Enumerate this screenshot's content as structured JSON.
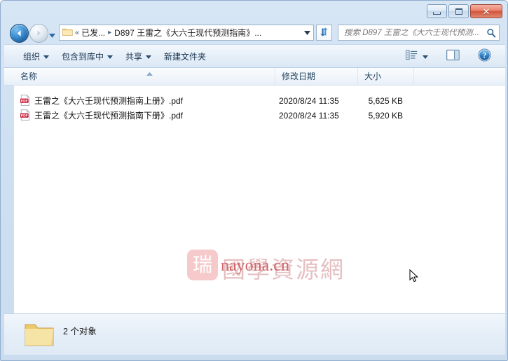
{
  "window": {
    "controls": {
      "minimize_label": "最小化",
      "maximize_label": "最大化",
      "close_label": "✕"
    }
  },
  "navbar": {
    "back_tooltip": "后退",
    "forward_tooltip": "前进",
    "recent_pages_tooltip": "最近浏览的页面",
    "breadcrumb": {
      "overflow": "«",
      "parent": "已发...",
      "separator": "▸",
      "current": "D897 王雷之《大六壬现代预测指南》",
      "ellipsis": "...",
      "dropdown_tooltip": "上一个位置"
    },
    "refresh_tooltip": "刷新"
  },
  "search": {
    "placeholder": "搜索 D897 王雷之《大六壬现代预测...",
    "value": "",
    "icon": "search-icon"
  },
  "toolbar": {
    "items": [
      {
        "label": "组织",
        "has_dropdown": true
      },
      {
        "label": "包含到库中",
        "has_dropdown": true
      },
      {
        "label": "共享",
        "has_dropdown": true
      },
      {
        "label": "新建文件夹",
        "has_dropdown": false
      }
    ],
    "right_icons": [
      {
        "name": "view-layout-icon",
        "has_dropdown": true
      },
      {
        "name": "preview-pane-icon",
        "has_dropdown": false
      },
      {
        "name": "help-icon",
        "has_dropdown": false
      }
    ]
  },
  "columns": [
    {
      "key": "name",
      "label": "名称",
      "sorted": "asc"
    },
    {
      "key": "date",
      "label": "修改日期",
      "sorted": ""
    },
    {
      "key": "size",
      "label": "大小",
      "sorted": ""
    }
  ],
  "files": [
    {
      "icon": "pdf-file-icon",
      "name": "王雷之《大六壬现代预测指南上册》.pdf",
      "date": "2020/8/24 11:35",
      "size": "5,625 KB"
    },
    {
      "icon": "pdf-file-icon",
      "name": "王雷之《大六壬现代预测指南下册》.pdf",
      "date": "2020/8/24 11:35",
      "size": "5,920 KB"
    }
  ],
  "watermark": {
    "logo_glyph": "瑞",
    "chinese": "國學資源網",
    "url": "nayona.cn"
  },
  "statusbar": {
    "icon": "folder-icon",
    "text": "2 个对象"
  },
  "colors": {
    "frame": "#cfe0f2",
    "accent": "#1d5f9e",
    "close_red": "#d1553c",
    "watermark_pink": "#e6bfc1",
    "watermark_red": "#d0656a"
  }
}
